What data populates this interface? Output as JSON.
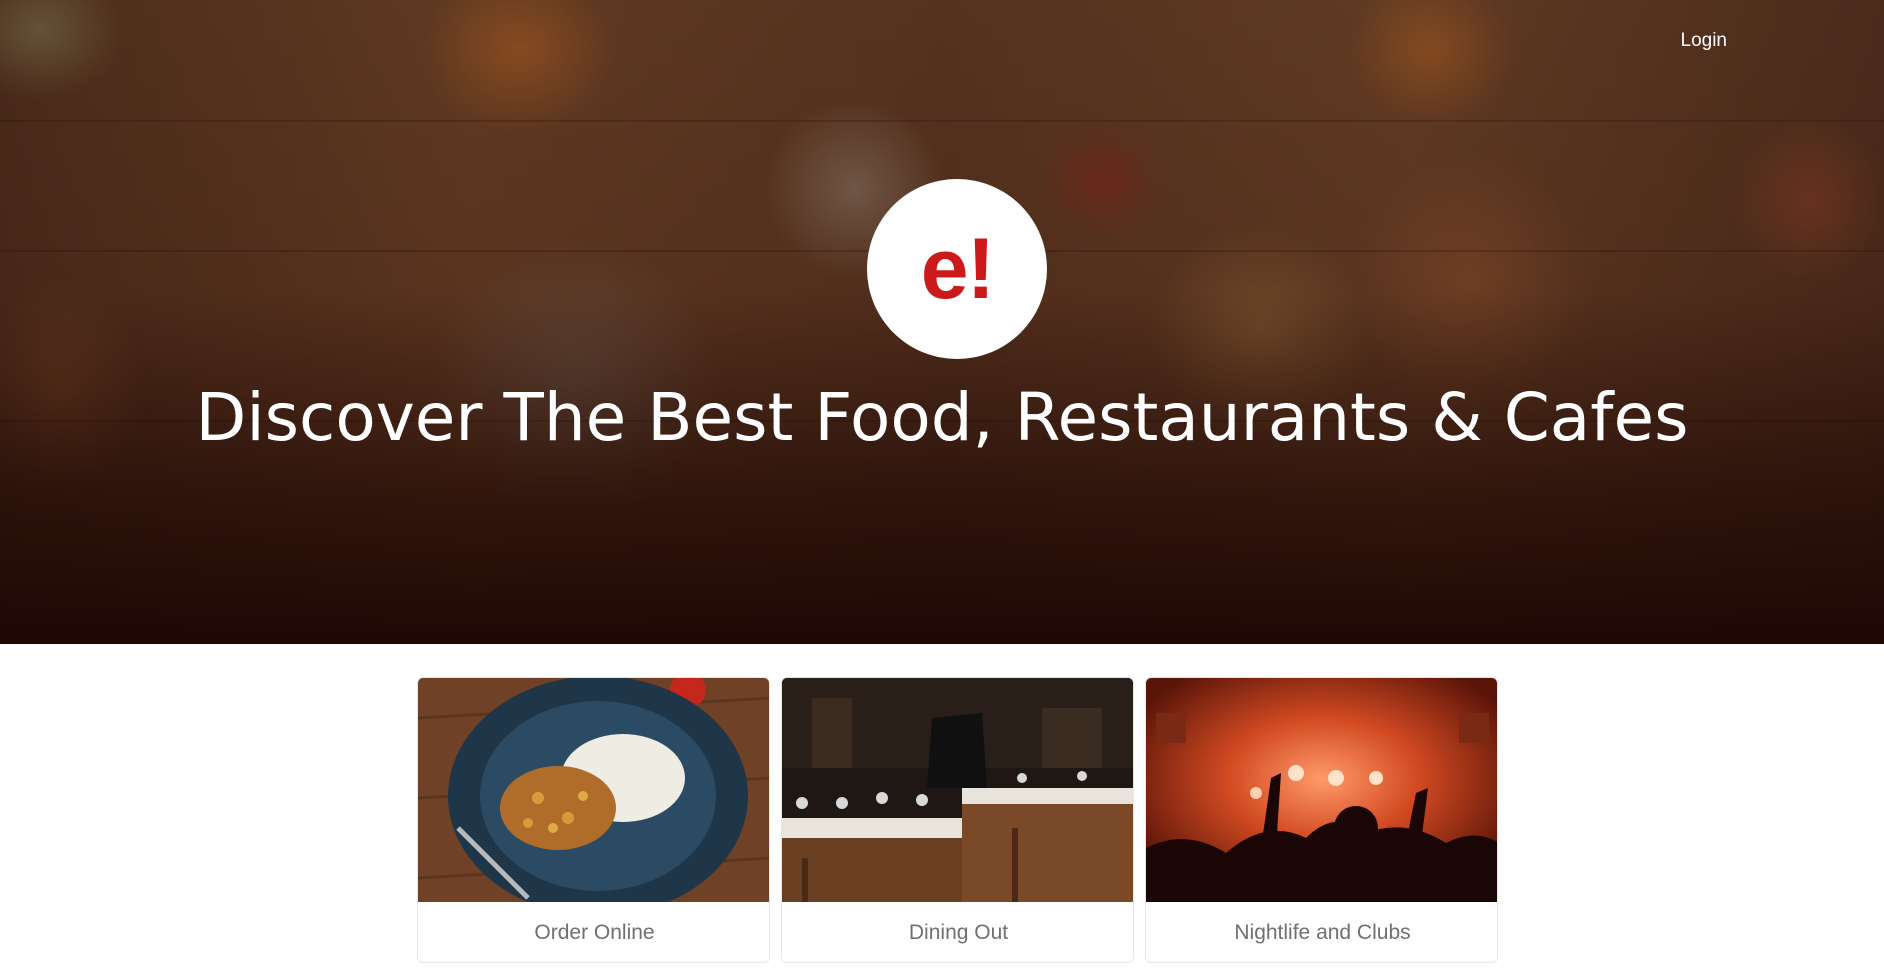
{
  "header": {
    "login_label": "Login"
  },
  "hero": {
    "logo_text": "e!",
    "headline": "Discover The Best Food, Restaurants & Cafes"
  },
  "categories": [
    {
      "label": "Order Online",
      "icon": "food-plate-image"
    },
    {
      "label": "Dining Out",
      "icon": "restaurant-interior-image"
    },
    {
      "label": "Nightlife and Clubs",
      "icon": "nightclub-crowd-image"
    }
  ],
  "colors": {
    "brand_red": "#cc1a1a",
    "card_label": "#707070",
    "hero_text": "#ffffff"
  }
}
